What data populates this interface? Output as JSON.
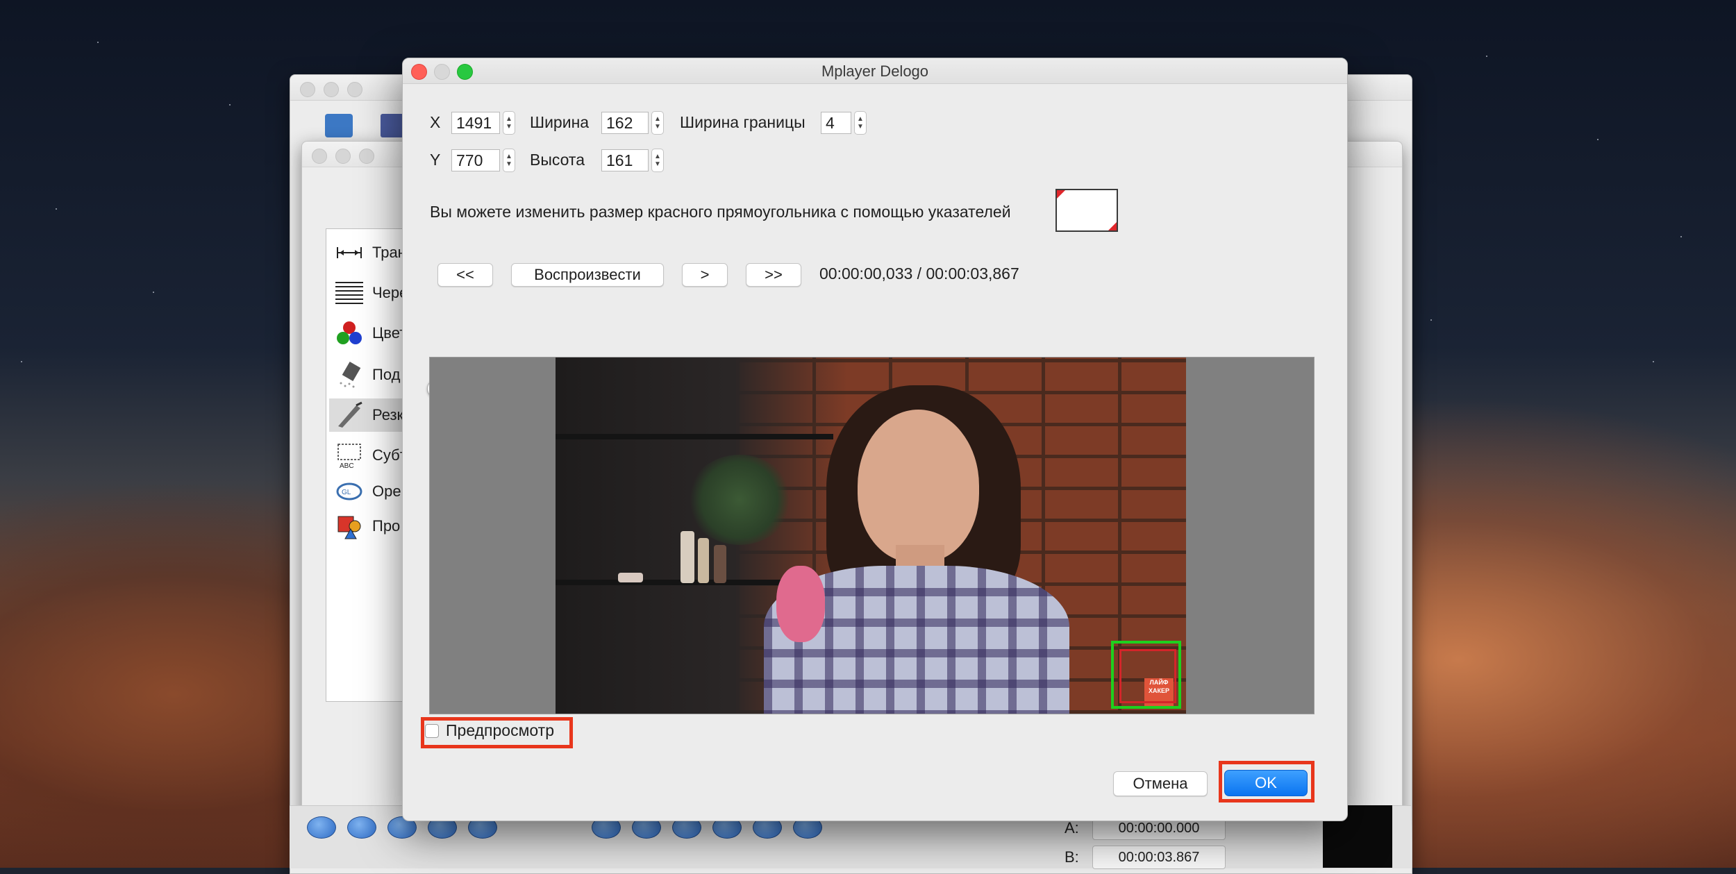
{
  "dialog": {
    "title": "Mplayer Delogo",
    "x_label": "X",
    "x_value": "1491",
    "y_label": "Y",
    "y_value": "770",
    "width_label": "Ширина",
    "width_value": "162",
    "height_label": "Высота",
    "height_value": "161",
    "border_label": "Ширина границы",
    "border_value": "4",
    "hint": "Вы можете изменить размер красного прямоугольника с помощью указателей",
    "btn_prev": "<<",
    "btn_play": "Воспроизвести",
    "btn_step": ">",
    "btn_next": ">>",
    "timecode": "00:00:00,033 / 00:00:03,867",
    "preview_label": "Предпросмотр",
    "cancel_label": "Отмена",
    "ok_label": "OK",
    "watermark_text": "ЛАЙФ ХАКЕР"
  },
  "background_window": {
    "filters": [
      {
        "label": "Тран",
        "icon": "arrow-width-icon"
      },
      {
        "label": "Черес",
        "icon": "lines-icon"
      },
      {
        "label": "Цвет",
        "icon": "color-balls-icon"
      },
      {
        "label": "Под",
        "icon": "eraser-icon"
      },
      {
        "label": "Резк",
        "icon": "knife-icon"
      },
      {
        "label": "Субт",
        "icon": "subtitle-icon"
      },
      {
        "label": "Open",
        "icon": "opengl-icon"
      },
      {
        "label": "Про",
        "icon": "shapes-icon"
      }
    ],
    "marker_a_label": "A:",
    "marker_a_value": "00:00:00.000",
    "marker_b_label": "B:",
    "marker_b_value": "00:00:03.867"
  },
  "colors": {
    "highlight": "#e8361c",
    "accent": "#0a74f0",
    "logo_box_green": "#1ed01e",
    "logo_box_red": "#d4252a"
  }
}
